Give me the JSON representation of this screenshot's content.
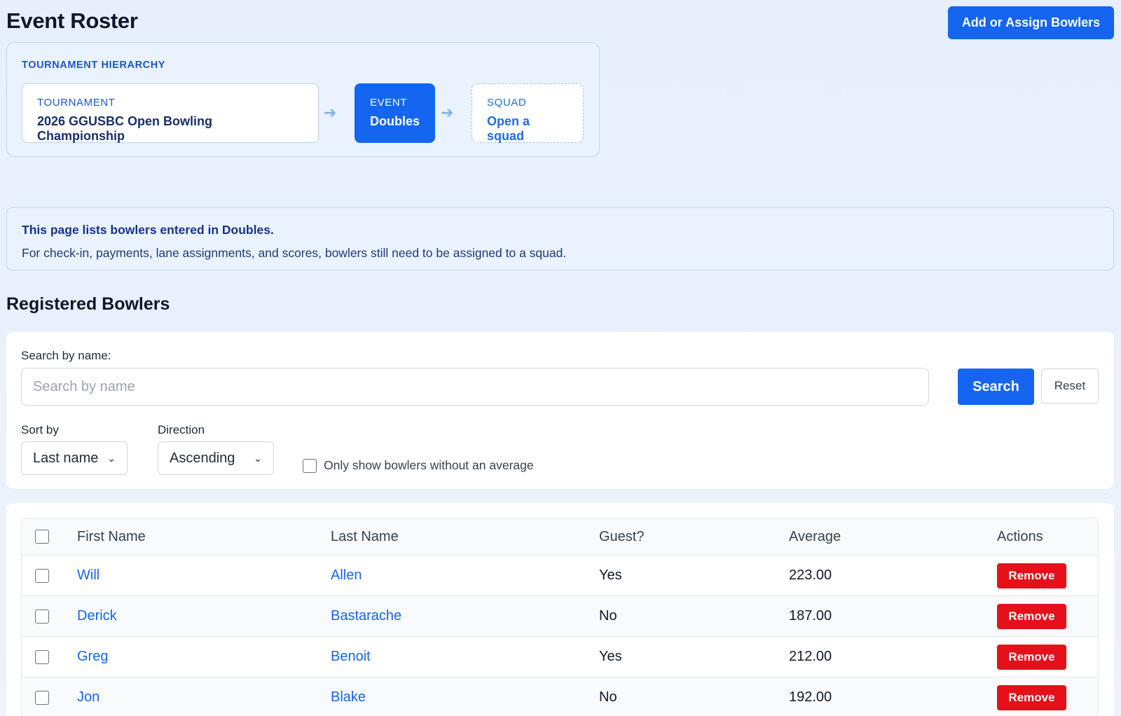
{
  "header": {
    "title": "Event Roster",
    "add_button": "Add or Assign Bowlers"
  },
  "hierarchy": {
    "label": "TOURNAMENT HIERARCHY",
    "tournament": {
      "key": "TOURNAMENT",
      "value": "2026 GGUSBC Open Bowling Championship"
    },
    "event": {
      "key": "EVENT",
      "value": "Doubles"
    },
    "squad": {
      "key": "SQUAD",
      "value": "Open a squad"
    }
  },
  "info": {
    "line1": "This page lists bowlers entered in Doubles.",
    "line2": "For check-in, payments, lane assignments, and scores, bowlers still need to be assigned to a squad."
  },
  "section_title": "Registered Bowlers",
  "filters": {
    "search_label": "Search by name:",
    "search_placeholder": "Search by name",
    "search_value": "",
    "search_button": "Search",
    "reset_button": "Reset",
    "sort_label": "Sort by",
    "sort_value": "Last name",
    "direction_label": "Direction",
    "direction_value": "Ascending",
    "no_average_label": "Only show bowlers without an average"
  },
  "table": {
    "columns": [
      "First Name",
      "Last Name",
      "Guest?",
      "Average",
      "Actions"
    ],
    "remove_label": "Remove",
    "rows": [
      {
        "first": "Will",
        "last": "Allen",
        "guest": "Yes",
        "average": "223.00"
      },
      {
        "first": "Derick",
        "last": "Bastarache",
        "guest": "No",
        "average": "187.00"
      },
      {
        "first": "Greg",
        "last": "Benoit",
        "guest": "Yes",
        "average": "212.00"
      },
      {
        "first": "Jon",
        "last": "Blake",
        "guest": "No",
        "average": "192.00"
      }
    ]
  },
  "colors": {
    "primary": "#1565f0",
    "danger": "#e5101a",
    "panel_bg": "#eaf2fd"
  }
}
